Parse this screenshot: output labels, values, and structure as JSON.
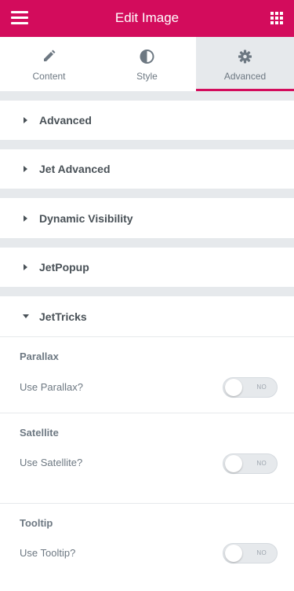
{
  "header": {
    "title": "Edit Image",
    "menu_icon": "hamburger-menu-icon",
    "apps_icon": "apps-grid-icon",
    "bg_color": "#d30c5c"
  },
  "tabs": [
    {
      "label": "Content",
      "icon": "pencil-icon",
      "active": false
    },
    {
      "label": "Style",
      "icon": "contrast-icon",
      "active": false
    },
    {
      "label": "Advanced",
      "icon": "gear-icon",
      "active": true
    }
  ],
  "sections": [
    {
      "title": "Advanced",
      "expanded": false
    },
    {
      "title": "Jet Advanced",
      "expanded": false
    },
    {
      "title": "Dynamic Visibility",
      "expanded": false
    },
    {
      "title": "JetPopup",
      "expanded": false
    },
    {
      "title": "JetTricks",
      "expanded": true
    }
  ],
  "jettricks": {
    "groups": [
      {
        "heading": "Parallax",
        "label": "Use Parallax?",
        "toggle": "NO"
      },
      {
        "heading": "Satellite",
        "label": "Use Satellite?",
        "toggle": "NO"
      },
      {
        "heading": "Tooltip",
        "label": "Use Tooltip?",
        "toggle": "NO"
      }
    ]
  },
  "colors": {
    "accent": "#d30c5c",
    "panel_gap": "#e6e9ec",
    "text": "#495157"
  }
}
